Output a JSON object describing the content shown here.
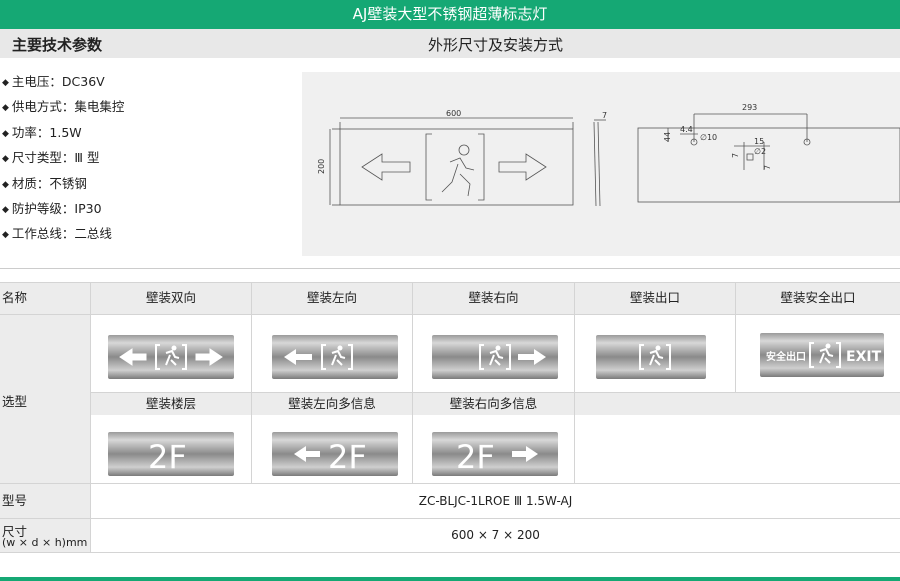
{
  "title": "AJ壁装大型不锈钢超薄标志灯",
  "sections": {
    "specs_heading": "主要技术参数",
    "drawing_heading": "外形尺寸及安装方式"
  },
  "specs": [
    "主电压：DC36V",
    "供电方式：集电集控",
    "功率：1.5W",
    "尺寸类型：Ⅲ 型",
    "材质：不锈钢",
    "防护等级：IP30",
    "工作总线：二总线"
  ],
  "drawing": {
    "dim_width": "600",
    "dim_height": "200",
    "dim_depth": "7",
    "dim_mount_spacing": "293",
    "dim_44": "44",
    "dim_44b": "4.4",
    "dim_hole": "∅10",
    "dim_15": "15",
    "dim_7a": "7",
    "dim_hole2": "∅2",
    "dim_7b": "7"
  },
  "table": {
    "row_labels": {
      "name": "名称",
      "selection": "选型",
      "model": "型号",
      "size_line1": "尺寸",
      "size_line2": "(w × d × h)mm"
    },
    "names_row1": [
      "壁装双向",
      "壁装左向",
      "壁装右向",
      "壁装出口",
      "壁装安全出口"
    ],
    "names_row2": [
      "壁装楼层",
      "壁装左向多信息",
      "壁装右向多信息"
    ],
    "model_value": "ZC-BLJC-1LROE Ⅲ 1.5W-AJ",
    "size_value": "600 × 7 × 200",
    "sign_texts": {
      "safe_exit_cn": "安全出口",
      "exit_en": "EXIT",
      "floor": "2F"
    }
  }
}
